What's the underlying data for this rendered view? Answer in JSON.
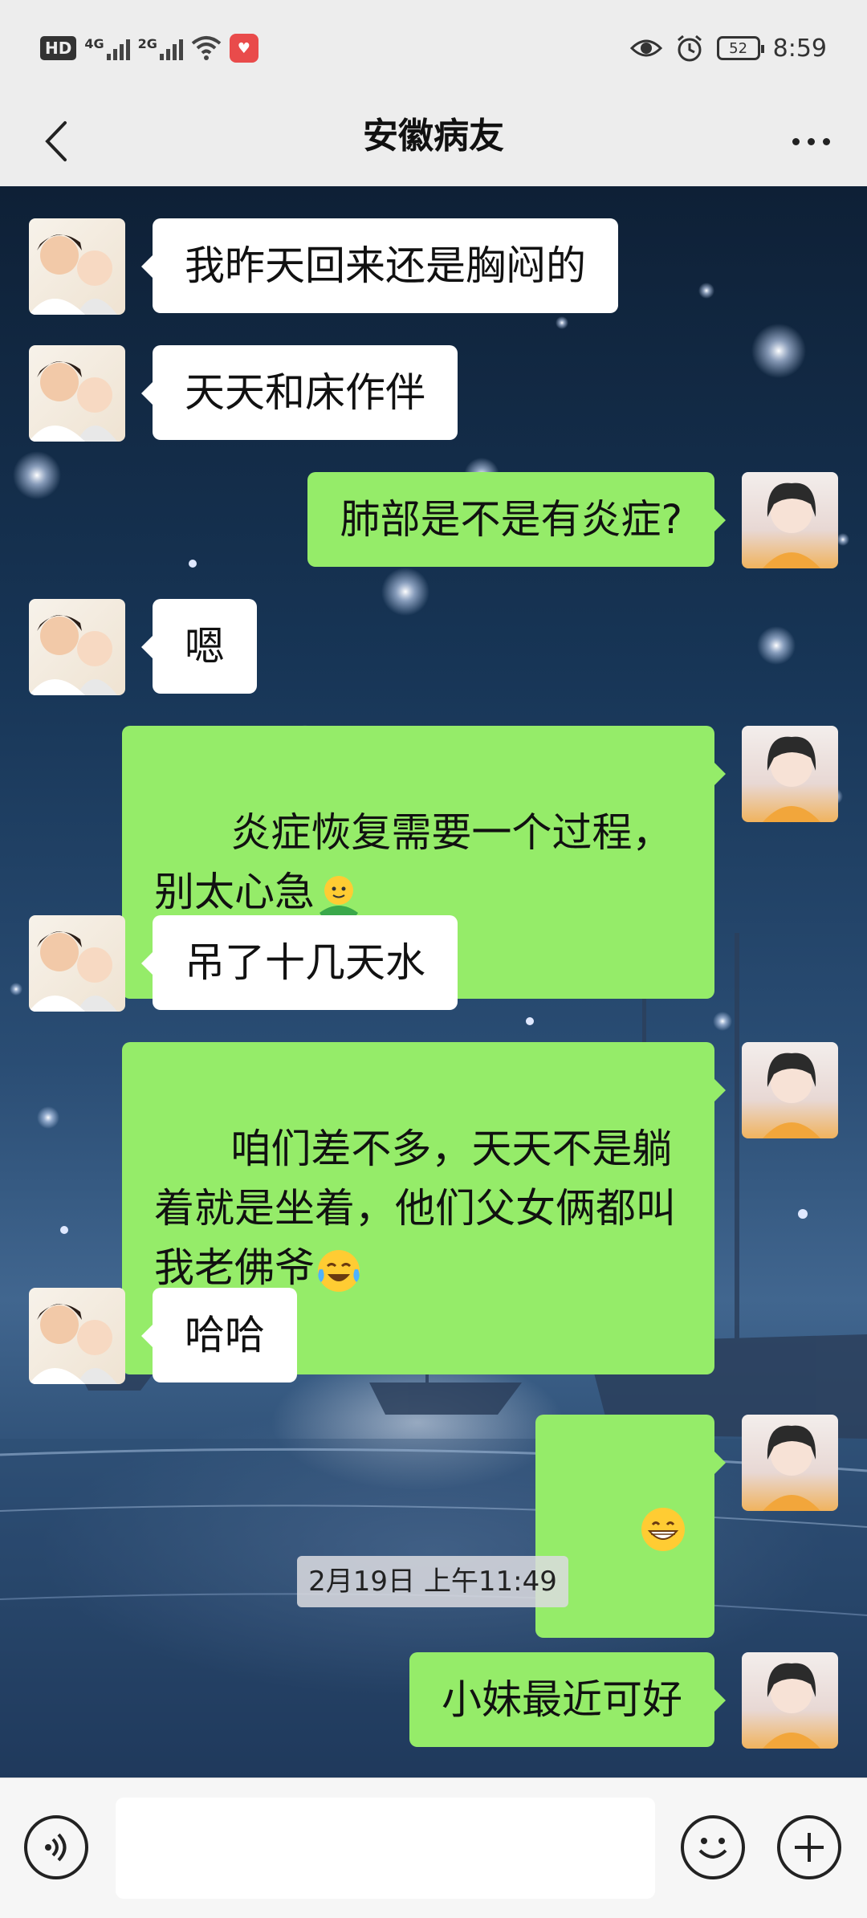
{
  "status_bar": {
    "hd_label": "HD",
    "net1_label": "4G",
    "net2_label": "2G",
    "battery": "52",
    "time": "8:59"
  },
  "header": {
    "title": "安徽病友"
  },
  "messages": [
    {
      "side": "in",
      "text": "我昨天回来还是胸闷的"
    },
    {
      "side": "in",
      "text": "天天和床作伴"
    },
    {
      "side": "out",
      "text": "肺部是不是有炎症?"
    },
    {
      "side": "in",
      "text": "嗯"
    },
    {
      "side": "out",
      "text": "炎症恢复需要一个过程，别太心急",
      "emoji": "hug-emoji"
    },
    {
      "side": "in",
      "text": "吊了十几天水"
    },
    {
      "side": "out",
      "text": "咱们差不多，天天不是躺着就是坐着，他们父女俩都叫我老佛爷",
      "emoji": "laugh-cry-emoji"
    },
    {
      "side": "in",
      "text": "哈哈"
    },
    {
      "side": "out",
      "text": "",
      "emoji": "grin-emoji"
    },
    {
      "side": "out",
      "text": "小妹最近可好"
    }
  ],
  "timestamp": "2月19日 上午11:49",
  "colors": {
    "bubble_out": "#95ec69",
    "bubble_in": "#ffffff",
    "bar_bg": "#ededed"
  },
  "icons": {
    "back": "back-arrow-icon",
    "more": "more-dots-icon",
    "voice": "voice-icon",
    "emoji": "emoji-icon",
    "plus": "plus-icon"
  }
}
